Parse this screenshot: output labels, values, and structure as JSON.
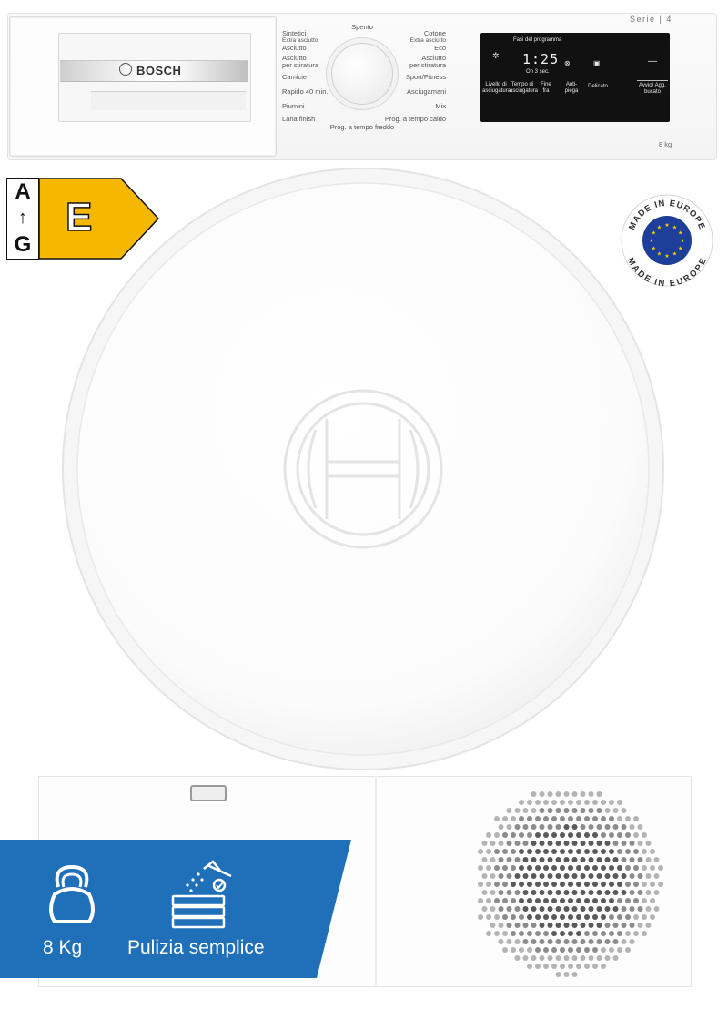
{
  "product": {
    "brand": "BOSCH",
    "series": "Serie | 4",
    "capacity": "8 kg"
  },
  "programs": {
    "top": "Spento",
    "left": [
      "Sintetici",
      "Extra asciutto",
      "Asciutto",
      "Asciutto",
      "per stiratura",
      "Camicie",
      "Rapido 40 min.",
      "Piumini",
      "Lana finish"
    ],
    "right": [
      "Cotone",
      "Extra asciutto",
      "Eco",
      "Asciutto",
      "per stiratura",
      "Sport/Fitness",
      "Asciugamani",
      "Mix",
      "Prog. a tempo caldo"
    ],
    "bottom": "Prog. a tempo freddo"
  },
  "display": {
    "header": "Fasi del programma",
    "time": "1:25",
    "sub": "On 3 sec.",
    "buttons": [
      "Livello di asciugatura",
      "Tempo di asciugatura",
      "Fine fra",
      "Anti-piega",
      "Delicato",
      "Avvio/ Agg. bucato"
    ]
  },
  "energy_label": {
    "scale_top": "A",
    "scale_arrow": "↑",
    "scale_bottom": "G",
    "class": "E",
    "class_color": "#f5b700"
  },
  "badge": {
    "text_top": "MADE IN EUROPE",
    "text_bottom": "MADE IN EUROPE",
    "eu_color": "#1d3f9a",
    "star_color": "#f6d200"
  },
  "features": {
    "banner_color": "#1f70b8",
    "items": [
      {
        "label": "8 Kg",
        "icon": "kettlebell-icon"
      },
      {
        "label": "Pulizia semplice",
        "icon": "filter-rinse-icon"
      }
    ]
  }
}
